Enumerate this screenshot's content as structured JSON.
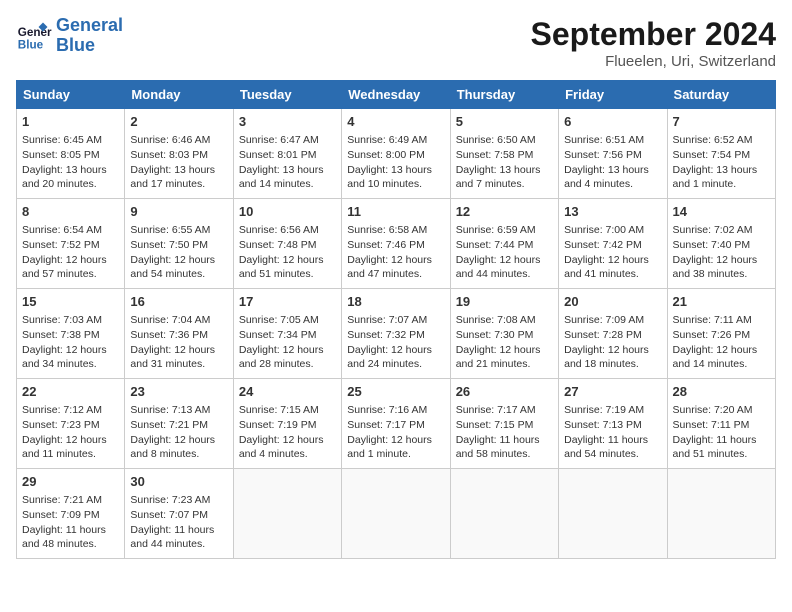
{
  "logo": {
    "line1": "General",
    "line2": "Blue"
  },
  "title": "September 2024",
  "subtitle": "Flueelen, Uri, Switzerland",
  "days_header": [
    "Sunday",
    "Monday",
    "Tuesday",
    "Wednesday",
    "Thursday",
    "Friday",
    "Saturday"
  ],
  "weeks": [
    [
      {
        "day": "1",
        "info": "Sunrise: 6:45 AM\nSunset: 8:05 PM\nDaylight: 13 hours\nand 20 minutes."
      },
      {
        "day": "2",
        "info": "Sunrise: 6:46 AM\nSunset: 8:03 PM\nDaylight: 13 hours\nand 17 minutes."
      },
      {
        "day": "3",
        "info": "Sunrise: 6:47 AM\nSunset: 8:01 PM\nDaylight: 13 hours\nand 14 minutes."
      },
      {
        "day": "4",
        "info": "Sunrise: 6:49 AM\nSunset: 8:00 PM\nDaylight: 13 hours\nand 10 minutes."
      },
      {
        "day": "5",
        "info": "Sunrise: 6:50 AM\nSunset: 7:58 PM\nDaylight: 13 hours\nand 7 minutes."
      },
      {
        "day": "6",
        "info": "Sunrise: 6:51 AM\nSunset: 7:56 PM\nDaylight: 13 hours\nand 4 minutes."
      },
      {
        "day": "7",
        "info": "Sunrise: 6:52 AM\nSunset: 7:54 PM\nDaylight: 13 hours\nand 1 minute."
      }
    ],
    [
      {
        "day": "8",
        "info": "Sunrise: 6:54 AM\nSunset: 7:52 PM\nDaylight: 12 hours\nand 57 minutes."
      },
      {
        "day": "9",
        "info": "Sunrise: 6:55 AM\nSunset: 7:50 PM\nDaylight: 12 hours\nand 54 minutes."
      },
      {
        "day": "10",
        "info": "Sunrise: 6:56 AM\nSunset: 7:48 PM\nDaylight: 12 hours\nand 51 minutes."
      },
      {
        "day": "11",
        "info": "Sunrise: 6:58 AM\nSunset: 7:46 PM\nDaylight: 12 hours\nand 47 minutes."
      },
      {
        "day": "12",
        "info": "Sunrise: 6:59 AM\nSunset: 7:44 PM\nDaylight: 12 hours\nand 44 minutes."
      },
      {
        "day": "13",
        "info": "Sunrise: 7:00 AM\nSunset: 7:42 PM\nDaylight: 12 hours\nand 41 minutes."
      },
      {
        "day": "14",
        "info": "Sunrise: 7:02 AM\nSunset: 7:40 PM\nDaylight: 12 hours\nand 38 minutes."
      }
    ],
    [
      {
        "day": "15",
        "info": "Sunrise: 7:03 AM\nSunset: 7:38 PM\nDaylight: 12 hours\nand 34 minutes."
      },
      {
        "day": "16",
        "info": "Sunrise: 7:04 AM\nSunset: 7:36 PM\nDaylight: 12 hours\nand 31 minutes."
      },
      {
        "day": "17",
        "info": "Sunrise: 7:05 AM\nSunset: 7:34 PM\nDaylight: 12 hours\nand 28 minutes."
      },
      {
        "day": "18",
        "info": "Sunrise: 7:07 AM\nSunset: 7:32 PM\nDaylight: 12 hours\nand 24 minutes."
      },
      {
        "day": "19",
        "info": "Sunrise: 7:08 AM\nSunset: 7:30 PM\nDaylight: 12 hours\nand 21 minutes."
      },
      {
        "day": "20",
        "info": "Sunrise: 7:09 AM\nSunset: 7:28 PM\nDaylight: 12 hours\nand 18 minutes."
      },
      {
        "day": "21",
        "info": "Sunrise: 7:11 AM\nSunset: 7:26 PM\nDaylight: 12 hours\nand 14 minutes."
      }
    ],
    [
      {
        "day": "22",
        "info": "Sunrise: 7:12 AM\nSunset: 7:23 PM\nDaylight: 12 hours\nand 11 minutes."
      },
      {
        "day": "23",
        "info": "Sunrise: 7:13 AM\nSunset: 7:21 PM\nDaylight: 12 hours\nand 8 minutes."
      },
      {
        "day": "24",
        "info": "Sunrise: 7:15 AM\nSunset: 7:19 PM\nDaylight: 12 hours\nand 4 minutes."
      },
      {
        "day": "25",
        "info": "Sunrise: 7:16 AM\nSunset: 7:17 PM\nDaylight: 12 hours\nand 1 minute."
      },
      {
        "day": "26",
        "info": "Sunrise: 7:17 AM\nSunset: 7:15 PM\nDaylight: 11 hours\nand 58 minutes."
      },
      {
        "day": "27",
        "info": "Sunrise: 7:19 AM\nSunset: 7:13 PM\nDaylight: 11 hours\nand 54 minutes."
      },
      {
        "day": "28",
        "info": "Sunrise: 7:20 AM\nSunset: 7:11 PM\nDaylight: 11 hours\nand 51 minutes."
      }
    ],
    [
      {
        "day": "29",
        "info": "Sunrise: 7:21 AM\nSunset: 7:09 PM\nDaylight: 11 hours\nand 48 minutes."
      },
      {
        "day": "30",
        "info": "Sunrise: 7:23 AM\nSunset: 7:07 PM\nDaylight: 11 hours\nand 44 minutes."
      },
      {
        "day": "",
        "info": ""
      },
      {
        "day": "",
        "info": ""
      },
      {
        "day": "",
        "info": ""
      },
      {
        "day": "",
        "info": ""
      },
      {
        "day": "",
        "info": ""
      }
    ]
  ]
}
